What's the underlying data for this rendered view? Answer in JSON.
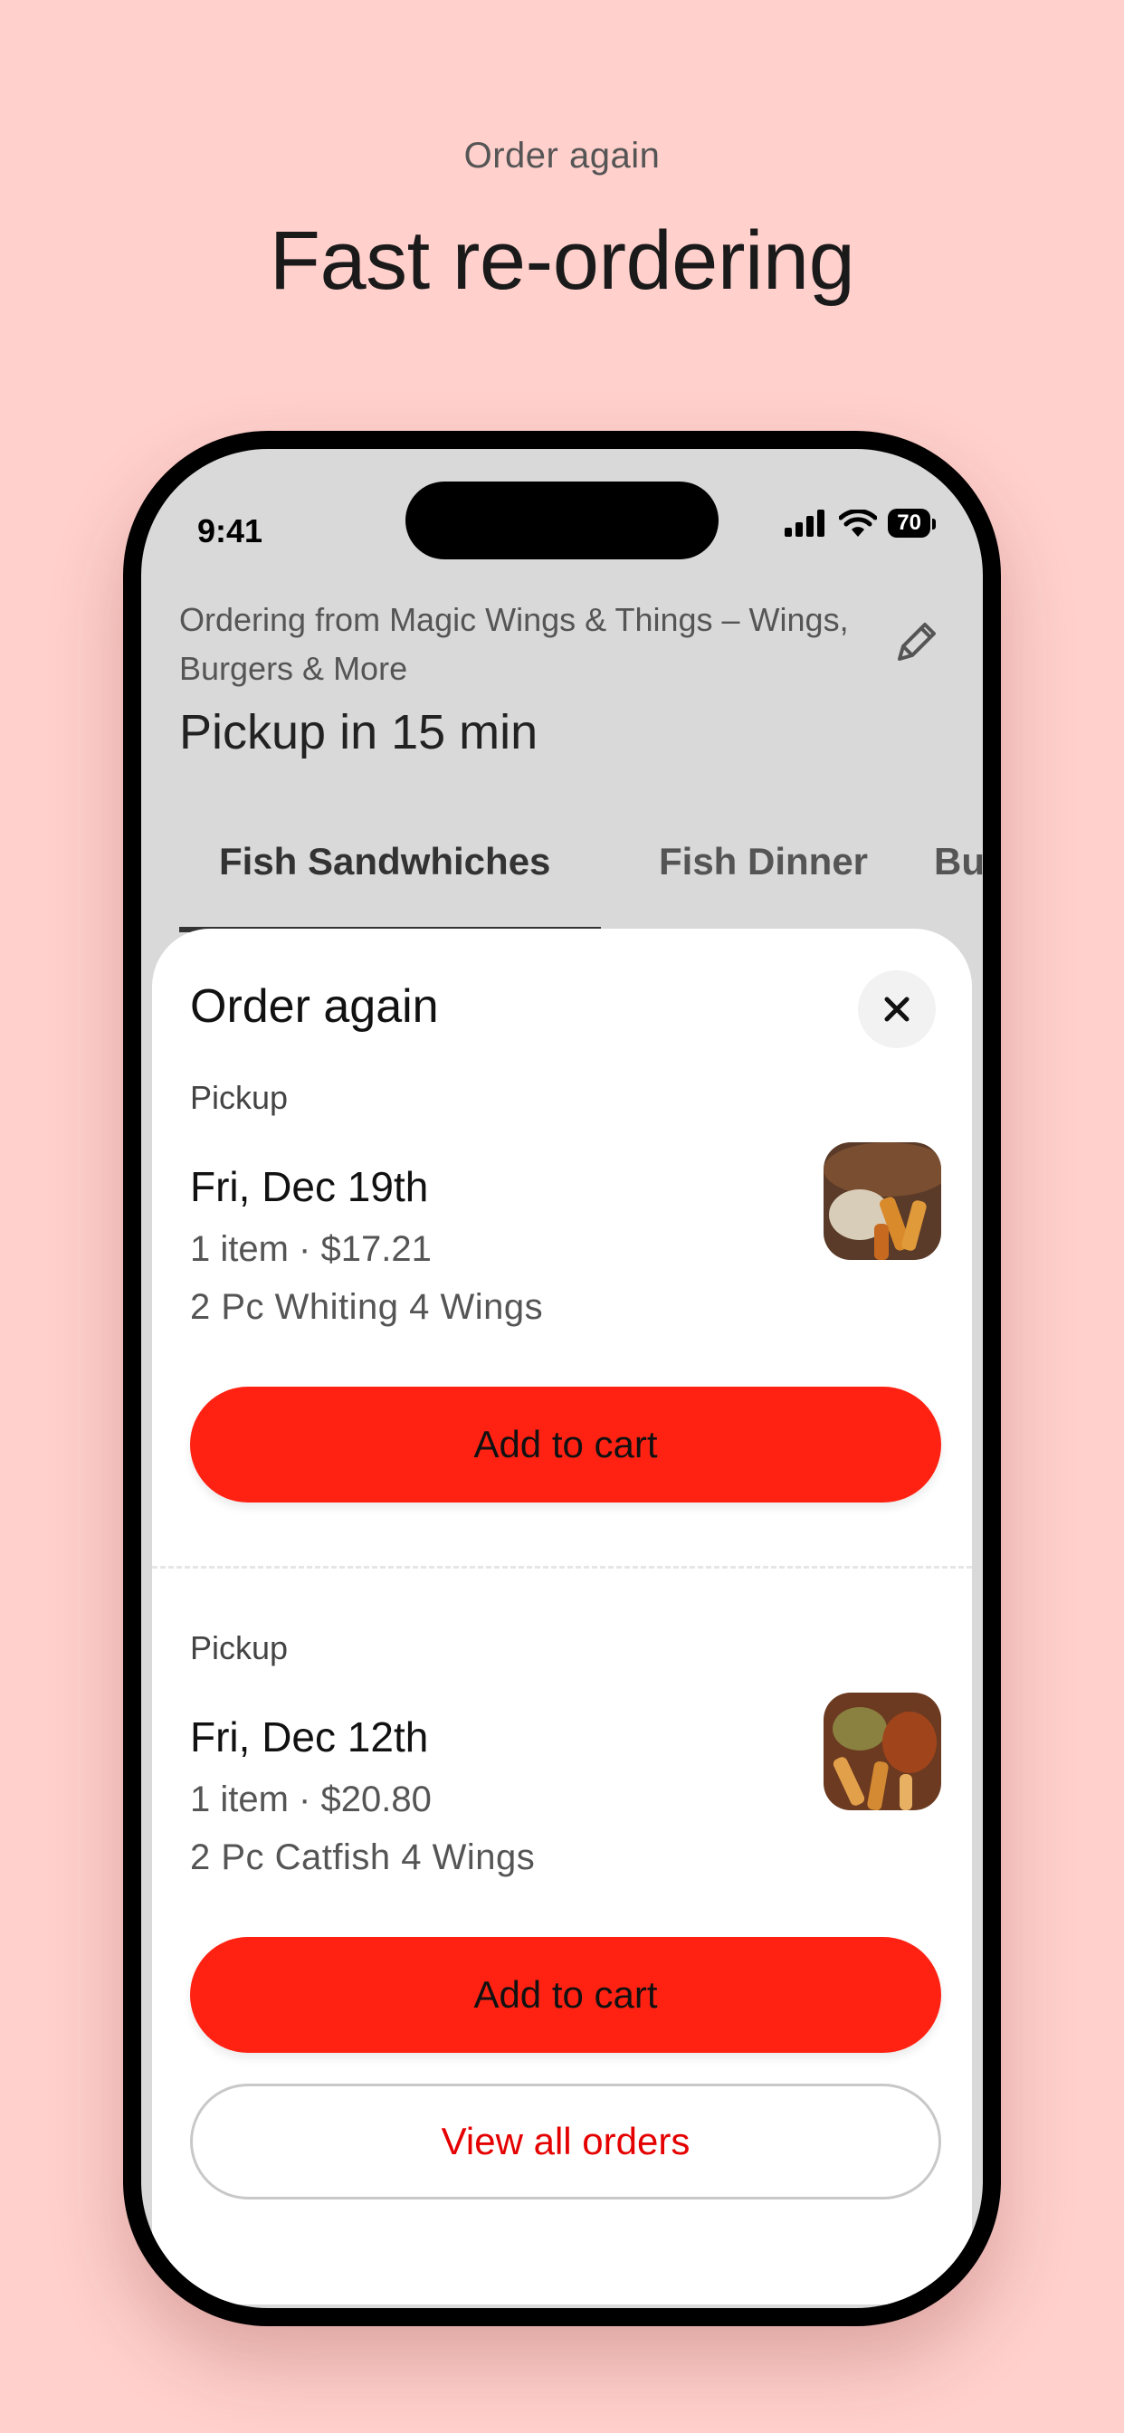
{
  "header": {
    "eyebrow": "Order again",
    "headline": "Fast re-ordering"
  },
  "status_bar": {
    "time": "9:41",
    "battery": "70"
  },
  "restaurant": {
    "ordering_from": "Ordering from Magic Wings & Things – Wings, Burgers & More",
    "pickup": "Pickup in 15 min"
  },
  "tabs": [
    {
      "label": "Fish Sandwhiches",
      "active": true
    },
    {
      "label": "Fish Dinner",
      "active": false
    },
    {
      "label": "Bu",
      "active": false
    }
  ],
  "sheet": {
    "title": "Order again",
    "orders": [
      {
        "mode": "Pickup",
        "date": "Fri, Dec 19th",
        "summary": "1 item · $17.21",
        "item": "2 Pc Whiting 4 Wings",
        "button": "Add to cart"
      },
      {
        "mode": "Pickup",
        "date": "Fri, Dec 12th",
        "summary": "1 item · $20.80",
        "item": "2 Pc Catfish 4 Wings",
        "button": "Add to cart"
      }
    ],
    "view_all": "View all orders"
  },
  "colors": {
    "background": "#ffd0cc",
    "primary_button": "#ff2213",
    "link_red": "#e50000"
  }
}
